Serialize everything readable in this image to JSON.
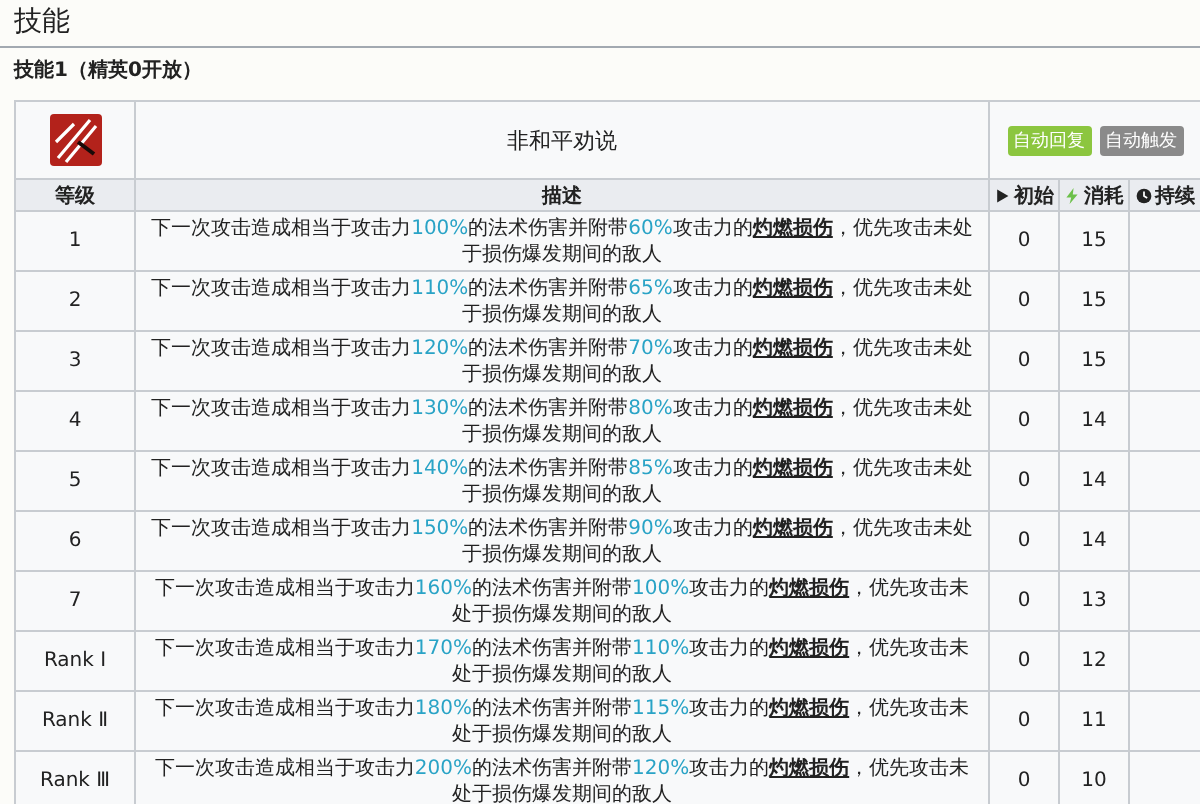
{
  "title": "技能",
  "skill_heading": "技能1（精英0开放）",
  "skill": {
    "name": "非和平劝说",
    "tags": [
      {
        "label": "自动回复",
        "color": "#8cc63f"
      },
      {
        "label": "自动触发",
        "color": "#8a8a8a"
      }
    ]
  },
  "columns": [
    {
      "label": "等级",
      "kind": "level"
    },
    {
      "label": "描述",
      "kind": "description"
    },
    {
      "label": "初始",
      "kind": "initial"
    },
    {
      "label": "消耗",
      "kind": "cost"
    },
    {
      "label": "持续",
      "kind": "duration"
    }
  ],
  "rows": [
    {
      "level": "1",
      "description": [
        {
          "kind": "plain",
          "text": "下一次攻击造成相当于攻击力"
        },
        {
          "kind": "value",
          "text": "100%"
        },
        {
          "kind": "plain",
          "text": "的法术伤害并附带"
        },
        {
          "kind": "value",
          "text": "60%"
        },
        {
          "kind": "plain",
          "text": "攻击力的"
        },
        {
          "kind": "term",
          "text": "灼燃损伤"
        },
        {
          "kind": "plain",
          "text": "，优先攻击未处于损伤爆发期间的敌人"
        }
      ],
      "initial": "0",
      "cost": "15"
    },
    {
      "level": "2",
      "description": [
        {
          "kind": "plain",
          "text": "下一次攻击造成相当于攻击力"
        },
        {
          "kind": "value",
          "text": "110%"
        },
        {
          "kind": "plain",
          "text": "的法术伤害并附带"
        },
        {
          "kind": "value",
          "text": "65%"
        },
        {
          "kind": "plain",
          "text": "攻击力的"
        },
        {
          "kind": "term",
          "text": "灼燃损伤"
        },
        {
          "kind": "plain",
          "text": "，优先攻击未处于损伤爆发期间的敌人"
        }
      ],
      "initial": "0",
      "cost": "15"
    },
    {
      "level": "3",
      "description": [
        {
          "kind": "plain",
          "text": "下一次攻击造成相当于攻击力"
        },
        {
          "kind": "value",
          "text": "120%"
        },
        {
          "kind": "plain",
          "text": "的法术伤害并附带"
        },
        {
          "kind": "value",
          "text": "70%"
        },
        {
          "kind": "plain",
          "text": "攻击力的"
        },
        {
          "kind": "term",
          "text": "灼燃损伤"
        },
        {
          "kind": "plain",
          "text": "，优先攻击未处于损伤爆发期间的敌人"
        }
      ],
      "initial": "0",
      "cost": "15"
    },
    {
      "level": "4",
      "description": [
        {
          "kind": "plain",
          "text": "下一次攻击造成相当于攻击力"
        },
        {
          "kind": "value",
          "text": "130%"
        },
        {
          "kind": "plain",
          "text": "的法术伤害并附带"
        },
        {
          "kind": "value",
          "text": "80%"
        },
        {
          "kind": "plain",
          "text": "攻击力的"
        },
        {
          "kind": "term",
          "text": "灼燃损伤"
        },
        {
          "kind": "plain",
          "text": "，优先攻击未处于损伤爆发期间的敌人"
        }
      ],
      "initial": "0",
      "cost": "14"
    },
    {
      "level": "5",
      "description": [
        {
          "kind": "plain",
          "text": "下一次攻击造成相当于攻击力"
        },
        {
          "kind": "value",
          "text": "140%"
        },
        {
          "kind": "plain",
          "text": "的法术伤害并附带"
        },
        {
          "kind": "value",
          "text": "85%"
        },
        {
          "kind": "plain",
          "text": "攻击力的"
        },
        {
          "kind": "term",
          "text": "灼燃损伤"
        },
        {
          "kind": "plain",
          "text": "，优先攻击未处于损伤爆发期间的敌人"
        }
      ],
      "initial": "0",
      "cost": "14"
    },
    {
      "level": "6",
      "description": [
        {
          "kind": "plain",
          "text": "下一次攻击造成相当于攻击力"
        },
        {
          "kind": "value",
          "text": "150%"
        },
        {
          "kind": "plain",
          "text": "的法术伤害并附带"
        },
        {
          "kind": "value",
          "text": "90%"
        },
        {
          "kind": "plain",
          "text": "攻击力的"
        },
        {
          "kind": "term",
          "text": "灼燃损伤"
        },
        {
          "kind": "plain",
          "text": "，优先攻击未处于损伤爆发期间的敌人"
        }
      ],
      "initial": "0",
      "cost": "14"
    },
    {
      "level": "7",
      "description": [
        {
          "kind": "plain",
          "text": "下一次攻击造成相当于攻击力"
        },
        {
          "kind": "value",
          "text": "160%"
        },
        {
          "kind": "plain",
          "text": "的法术伤害并附带"
        },
        {
          "kind": "value",
          "text": "100%"
        },
        {
          "kind": "plain",
          "text": "攻击力的"
        },
        {
          "kind": "term",
          "text": "灼燃损伤"
        },
        {
          "kind": "plain",
          "text": "，优先攻击未处于损伤爆发期间的敌人"
        }
      ],
      "initial": "0",
      "cost": "13"
    },
    {
      "level": "Rank Ⅰ",
      "description": [
        {
          "kind": "plain",
          "text": "下一次攻击造成相当于攻击力"
        },
        {
          "kind": "value",
          "text": "170%"
        },
        {
          "kind": "plain",
          "text": "的法术伤害并附带"
        },
        {
          "kind": "value",
          "text": "110%"
        },
        {
          "kind": "plain",
          "text": "攻击力的"
        },
        {
          "kind": "term",
          "text": "灼燃损伤"
        },
        {
          "kind": "plain",
          "text": "，优先攻击未处于损伤爆发期间的敌人"
        }
      ],
      "initial": "0",
      "cost": "12"
    },
    {
      "level": "Rank Ⅱ",
      "description": [
        {
          "kind": "plain",
          "text": "下一次攻击造成相当于攻击力"
        },
        {
          "kind": "value",
          "text": "180%"
        },
        {
          "kind": "plain",
          "text": "的法术伤害并附带"
        },
        {
          "kind": "value",
          "text": "115%"
        },
        {
          "kind": "plain",
          "text": "攻击力的"
        },
        {
          "kind": "term",
          "text": "灼燃损伤"
        },
        {
          "kind": "plain",
          "text": "，优先攻击未处于损伤爆发期间的敌人"
        }
      ],
      "initial": "0",
      "cost": "11"
    },
    {
      "level": "Rank Ⅲ",
      "description": [
        {
          "kind": "plain",
          "text": "下一次攻击造成相当于攻击力"
        },
        {
          "kind": "value",
          "text": "200%"
        },
        {
          "kind": "plain",
          "text": "的法术伤害并附带"
        },
        {
          "kind": "value",
          "text": "120%"
        },
        {
          "kind": "plain",
          "text": "攻击力的"
        },
        {
          "kind": "term",
          "text": "灼燃损伤"
        },
        {
          "kind": "plain",
          "text": "，优先攻击未处于损伤爆发期间的敌人"
        }
      ],
      "initial": "0",
      "cost": "10"
    }
  ]
}
